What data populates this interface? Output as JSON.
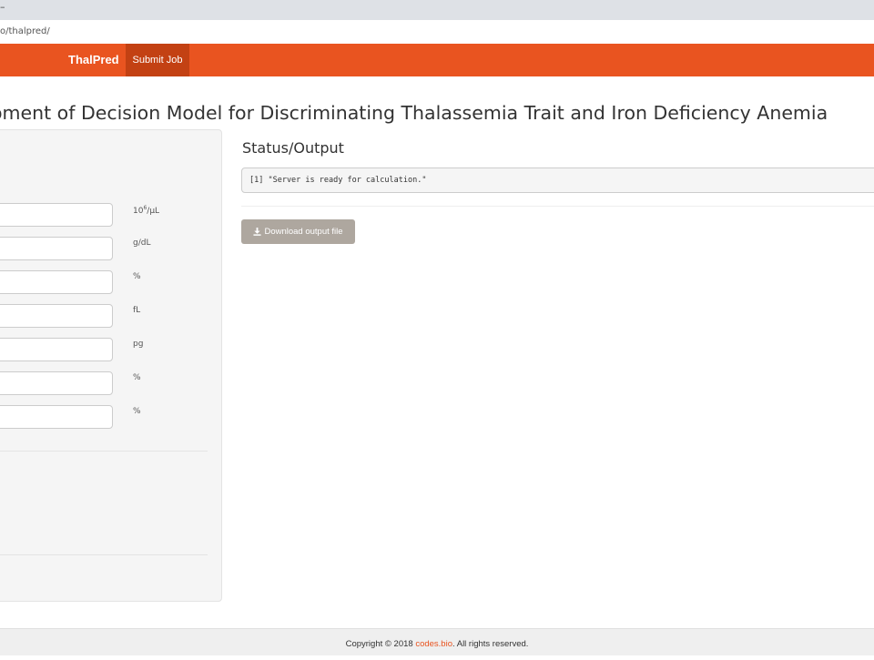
{
  "browser": {
    "tab_glyph": "–",
    "url": "o/thalpred/"
  },
  "navbar": {
    "brand": "ThalPred",
    "items": [
      {
        "label": "Submit Job"
      }
    ]
  },
  "page": {
    "title": "oment of Decision Model for Discriminating Thalassemia Trait and Iron Deficiency Anemia"
  },
  "input_panel": {
    "fields": [
      {
        "value": "",
        "unit_main": "10",
        "unit_sup": "6",
        "unit_rest": "/µL"
      },
      {
        "value": "",
        "unit": "g/dL"
      },
      {
        "value": "",
        "unit": "%"
      },
      {
        "value": "",
        "unit": "fL"
      },
      {
        "value": "",
        "unit": "pg"
      },
      {
        "value": "",
        "unit": "%"
      },
      {
        "value": "",
        "unit": "%"
      }
    ]
  },
  "output_panel": {
    "heading": "Status/Output",
    "console": "[1] \"Server is ready for calculation.\"",
    "download_label": "Download output file"
  },
  "footer": {
    "before": "Copyright © 2018 ",
    "link": "codes.bio",
    "after": ". All rights reserved."
  },
  "colors": {
    "navbar": "#e95420",
    "navbar_active": "#c34113",
    "button": "#aea79f",
    "link": "#e95420"
  }
}
